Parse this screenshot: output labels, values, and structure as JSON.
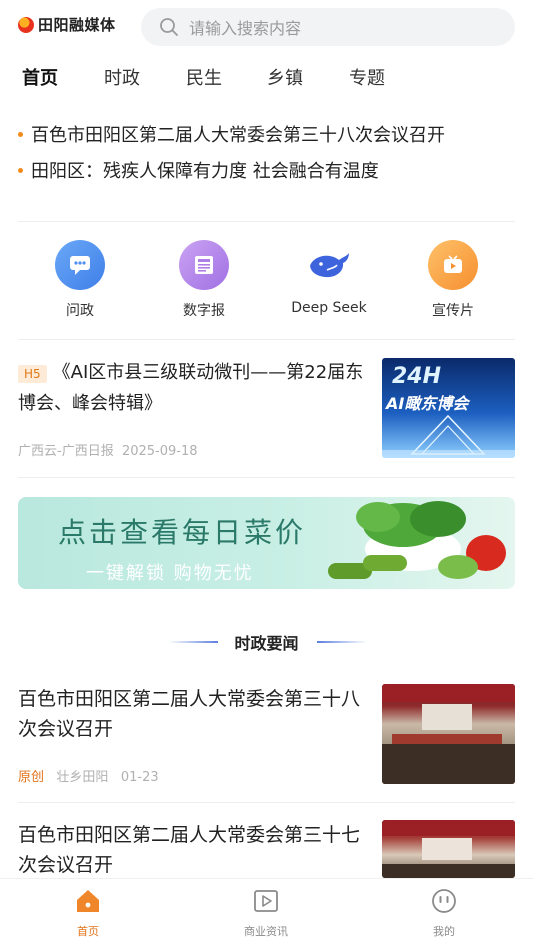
{
  "header": {
    "logo_text": "田阳融媒体",
    "search_placeholder": "请输入搜索内容"
  },
  "tabs": [
    {
      "label": "首页",
      "active": true
    },
    {
      "label": "时政",
      "active": false
    },
    {
      "label": "民生",
      "active": false
    },
    {
      "label": "乡镇",
      "active": false
    },
    {
      "label": "专题",
      "active": false
    }
  ],
  "headlines": [
    "百色市田阳区第二届人大常委会第三十八次会议召开",
    "田阳区：残疾人保障有力度  社会融合有温度"
  ],
  "quick_links": [
    {
      "label": "问政",
      "icon": "chat-bubble-icon",
      "color": "#4f8ff0"
    },
    {
      "label": "数字报",
      "icon": "newspaper-icon",
      "color": "#b07ee8"
    },
    {
      "label": "Deep Seek",
      "icon": "whale-icon",
      "color": "#3d63dd"
    },
    {
      "label": "宣传片",
      "icon": "video-play-icon",
      "color": "#f7a143"
    }
  ],
  "featured": {
    "badge": "H5",
    "title": "《AI区市县三级联动微刊——第22届东博会、峰会特辑》",
    "source": "广西云-广西日报",
    "date": "2025-09-18",
    "thumb_text": "24H",
    "thumb_sub": "AI瞰东博会"
  },
  "banner": {
    "title": "点击查看每日菜价",
    "subtitle": "一键解锁  购物无忧"
  },
  "section": {
    "title": "时政要闻"
  },
  "news": [
    {
      "title": "百色市田阳区第二届人大常委会第三十八次会议召开",
      "tag": "原创",
      "source": "壮乡田阳",
      "date": "01-23"
    },
    {
      "title": "百色市田阳区第二届人大常委会第三十七次会议召开"
    }
  ],
  "bottom_nav": [
    {
      "label": "首页",
      "icon": "home-icon",
      "active": true
    },
    {
      "label": "商业资讯",
      "icon": "play-square-icon",
      "active": false
    },
    {
      "label": "我的",
      "icon": "smiley-icon",
      "active": false
    }
  ],
  "colors": {
    "accent": "#e2731a",
    "dot": "#f28b1c",
    "section_line": "#5b7fe0"
  }
}
